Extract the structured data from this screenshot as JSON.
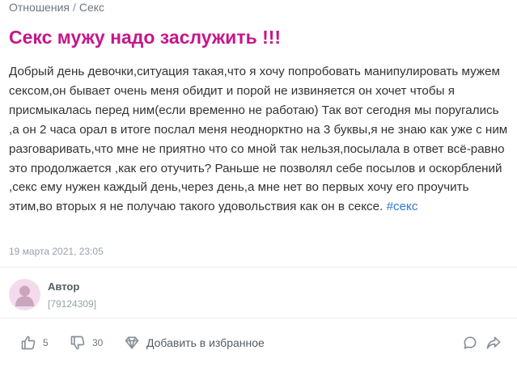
{
  "breadcrumb": {
    "items": [
      "Отношения",
      "Секс"
    ],
    "separator": "/"
  },
  "post": {
    "title": "Секс мужу надо заслужить !!!",
    "body": "Добрый день девочки,ситуация такая,что я хочу попробовать манипулировать мужем сексом,он бывает очень меня обидит и порой не извиняется он хочет чтобы я присмыкалась перед ним(если временно не работаю) Так вот сегодня мы поругались ,а он 2 часа орал в итоге послал меня неоднорктно на 3 буквы,я не знаю как уже с ним разговаривать,что мне не приятно что со мной так нельзя,посылала в ответ всё-равно это продолжается ,как его отучить? Раньше не позволял себе посылов и оскорблений ,секс ему нужен каждый день,через день,а мне нет во первых хочу его проучить этим,во вторых я не получаю такого удовольствия как он в сексе.",
    "hashtag": "#секс",
    "date": "19 марта 2021, 23:05"
  },
  "author": {
    "name": "Автор",
    "id": "[79124309]"
  },
  "actions": {
    "likes": "5",
    "dislikes": "30",
    "favorite_label": "Добавить в избранное"
  },
  "icons": {
    "like": "thumbs-up-icon",
    "dislike": "thumbs-down-icon",
    "favorite": "diamond-icon",
    "comment": "comment-icon",
    "share": "share-icon",
    "avatar": "user-silhouette-icon"
  },
  "colors": {
    "title": "#c5168c",
    "hashtag": "#2b7cd3",
    "avatar_bg": "#f3dbec",
    "avatar_figure": "#c9a6bd",
    "muted_text": "#9aa1ab",
    "icon": "#8a9099"
  }
}
